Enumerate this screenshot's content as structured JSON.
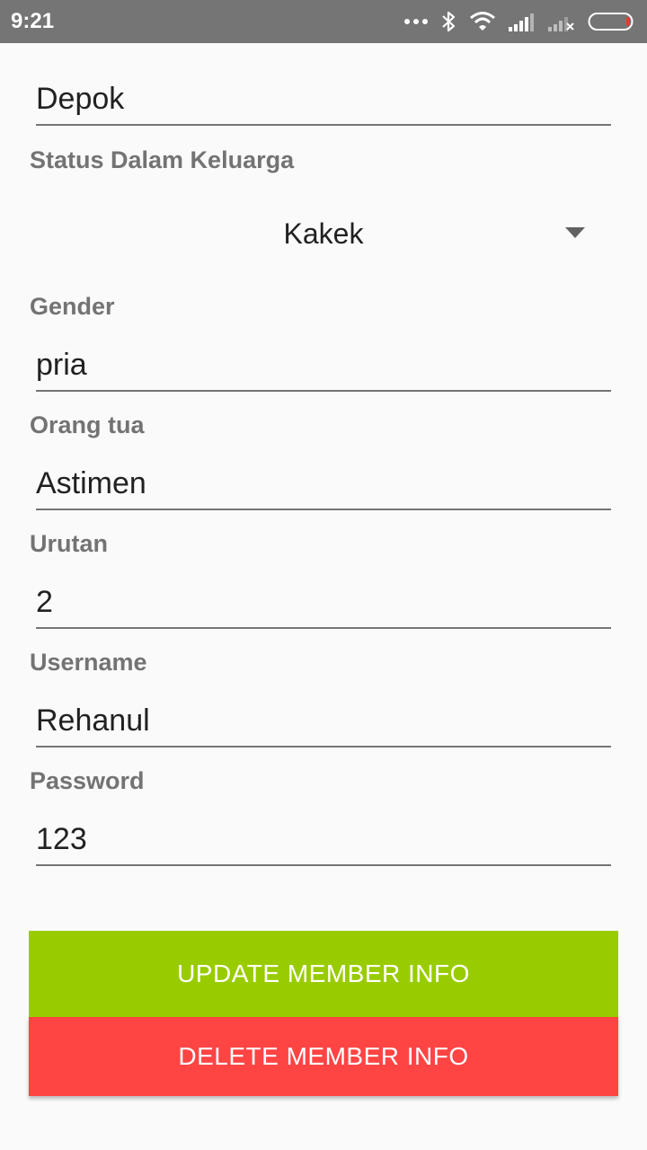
{
  "status_bar": {
    "time": "9:21"
  },
  "form": {
    "city_value": "Depok",
    "status_label": "Status Dalam Keluarga",
    "status_selected": "Kakek",
    "gender_label": "Gender",
    "gender_value": "pria",
    "parent_label": "Orang tua",
    "parent_value": "Astimen",
    "order_label": "Urutan",
    "order_value": "2",
    "username_label": "Username",
    "username_value": "Rehanul",
    "password_label": "Password",
    "password_value": "123"
  },
  "buttons": {
    "update_label": "UPDATE MEMBER INFO",
    "delete_label": "DELETE MEMBER INFO"
  },
  "colors": {
    "update_button": "#99cc00",
    "delete_button": "#ff4444",
    "status_bar": "#757575",
    "label_text": "#737373"
  },
  "icons": [
    "more-dots-icon",
    "bluetooth-icon",
    "wifi-icon",
    "signal-icon",
    "signal-no-sim-icon",
    "battery-low-icon",
    "dropdown-arrow-icon"
  ]
}
